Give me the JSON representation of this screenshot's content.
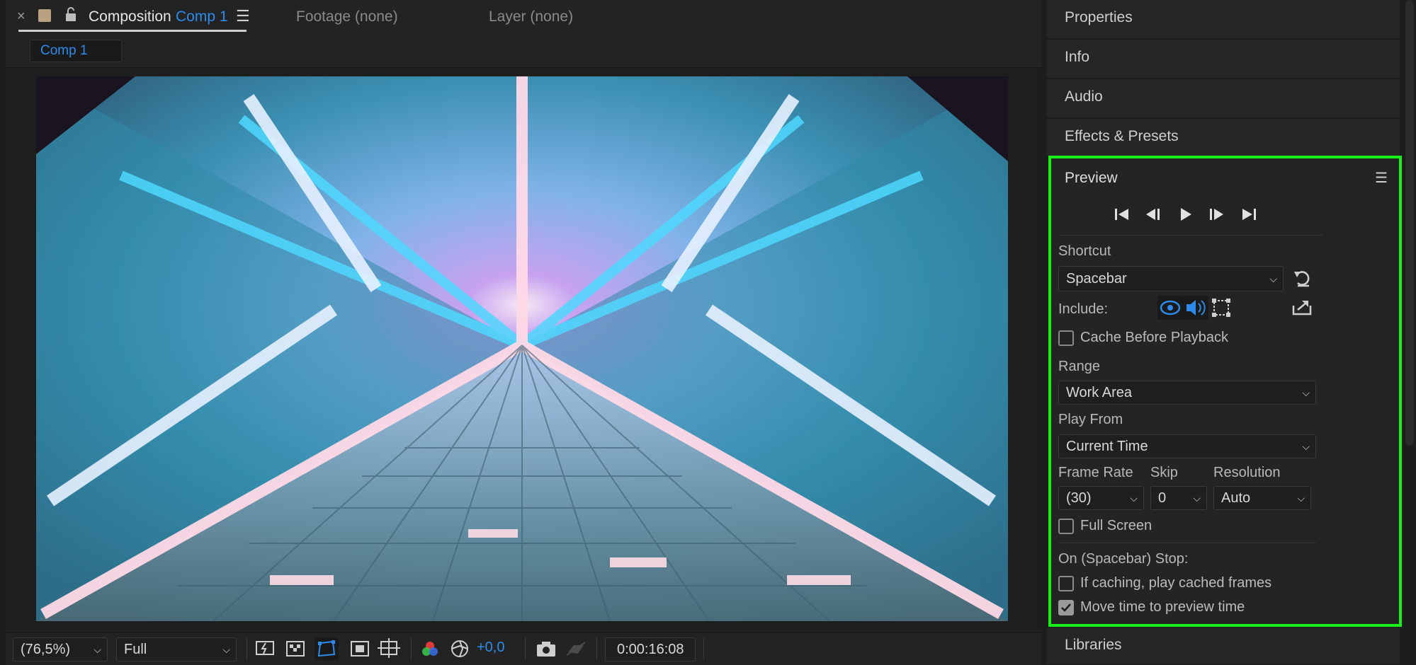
{
  "composition_tab": {
    "close_glyph": "×",
    "title": "Composition",
    "comp_name": "Comp 1",
    "menu_glyph": "☰",
    "footage_tab": "Footage (none)",
    "layer_tab": "Layer (none)",
    "comp_chip": "Comp 1"
  },
  "viewer_bar": {
    "zoom": "(76,5%)",
    "resolution": "Full",
    "exposure": "+0,0",
    "timecode": "0:00:16:08"
  },
  "panels": {
    "properties": "Properties",
    "info": "Info",
    "audio": "Audio",
    "effects": "Effects & Presets",
    "libraries": "Libraries"
  },
  "preview": {
    "title": "Preview",
    "menu_glyph": "☰",
    "shortcut_label": "Shortcut",
    "shortcut_value": "Spacebar",
    "include_label": "Include:",
    "cache_before_playback": "Cache Before Playback",
    "cache_checked": false,
    "range_label": "Range",
    "range_value": "Work Area",
    "play_from_label": "Play From",
    "play_from_value": "Current Time",
    "frame_rate_label": "Frame Rate",
    "frame_rate_value": "(30)",
    "skip_label": "Skip",
    "skip_value": "0",
    "resolution_label": "Resolution",
    "resolution_value": "Auto",
    "full_screen": "Full Screen",
    "full_screen_checked": false,
    "on_stop_label": "On (Spacebar) Stop:",
    "if_caching": "If caching, play cached frames",
    "if_caching_checked": false,
    "move_time": "Move time to preview time",
    "move_time_checked": true,
    "highlight_color": "#19f019"
  },
  "colors": {
    "accent_blue": "#2d8ceb",
    "panel_bg": "#242424"
  }
}
